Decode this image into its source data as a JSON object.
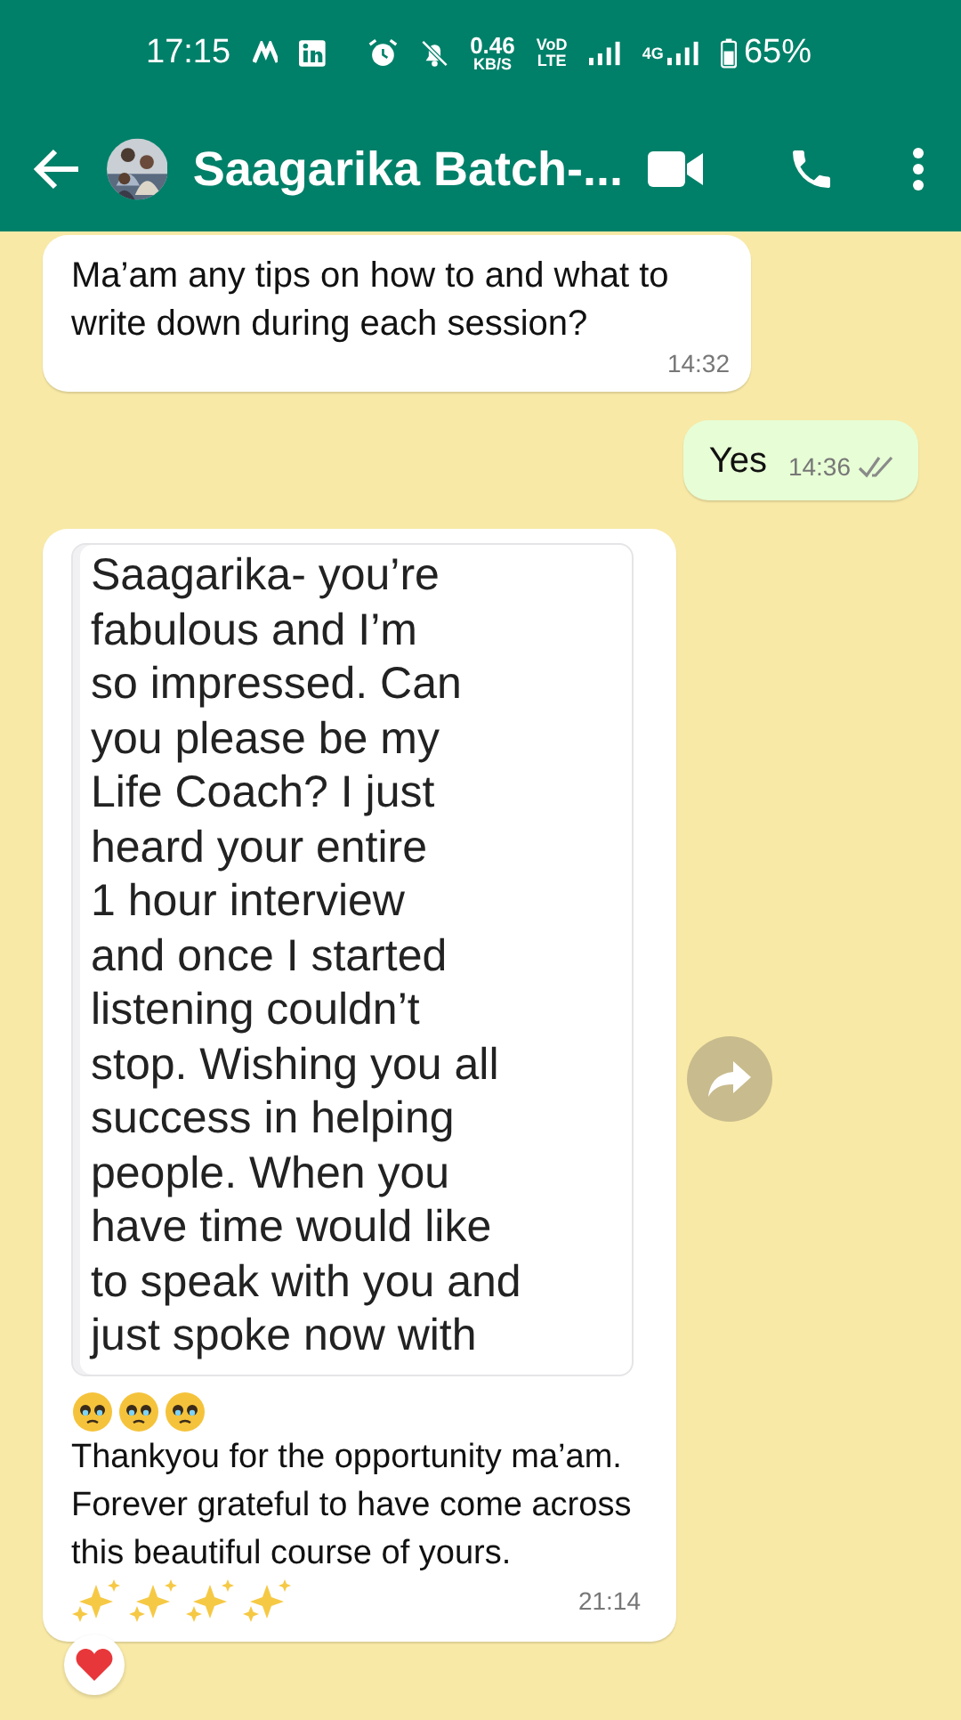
{
  "status_bar": {
    "time": "17:15",
    "speed": "0.46",
    "speed_unit": "KB/S",
    "volte_top": "VoD",
    "volte_bottom": "LTE",
    "network": "4G",
    "battery": "65%"
  },
  "header": {
    "title": "Saagarika Batch-..."
  },
  "messages": [
    {
      "kind": "text",
      "outgoing": false,
      "text": "Ma’am any tips on how to and what to write down during each session?",
      "time": "14:32"
    },
    {
      "kind": "text",
      "outgoing": true,
      "text": "Yes",
      "time": "14:36",
      "read": false
    },
    {
      "outgoing": false,
      "image_lines": [
        "Saagarika- you’re",
        "fabulous and I’m",
        "so impressed. Can",
        "you please be my",
        "Life Coach? I just",
        "heard your entire",
        "1 hour interview",
        "and once I started",
        "listening couldn’t",
        "stop. Wishing you all",
        "success in helping",
        "people. When you",
        "have time would like",
        "to speak with you and",
        "just spoke now with"
      ],
      "caption": "Thankyou for the opportunity ma’am. Forever grateful to have come across this beautiful course of yours.",
      "time": "21:14",
      "reaction": true
    }
  ]
}
